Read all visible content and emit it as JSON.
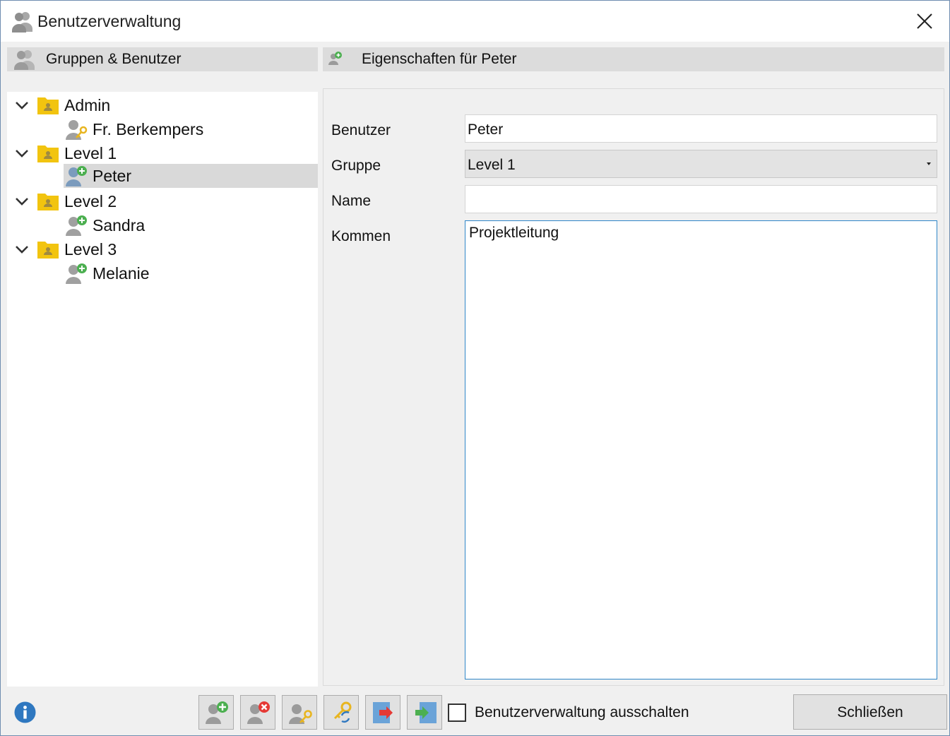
{
  "window": {
    "title": "Benutzerverwaltung",
    "title_icon": "users-icon",
    "close_icon": "close-icon"
  },
  "left_panel": {
    "header_label": "Gruppen & Benutzer",
    "header_icon": "users-icon"
  },
  "right_panel": {
    "header_label": "Eigenschaften für Peter",
    "header_icon": "user-add-icon"
  },
  "tree": {
    "items": [
      {
        "type": "group",
        "label": "Admin",
        "expanded": true
      },
      {
        "type": "user",
        "label": "Fr. Berkempers",
        "icon": "user-key-icon"
      },
      {
        "type": "group",
        "label": "Level 1",
        "expanded": true
      },
      {
        "type": "user",
        "label": "Peter",
        "icon": "user-add-icon",
        "selected": true
      },
      {
        "type": "group",
        "label": "Level 2",
        "expanded": true
      },
      {
        "type": "user",
        "label": "Sandra",
        "icon": "user-add-icon"
      },
      {
        "type": "group",
        "label": "Level 3",
        "expanded": true
      },
      {
        "type": "user",
        "label": "Melanie",
        "icon": "user-add-icon"
      }
    ]
  },
  "form": {
    "benutzer_label": "Benutzer",
    "benutzer_value": "Peter",
    "gruppe_label": "Gruppe",
    "gruppe_value": "Level 1",
    "name_label": "Name",
    "name_value": "",
    "kommen_label": "Kommen",
    "kommen_value": "Projektleitung"
  },
  "toolbar": {
    "buttons": [
      "add-user-icon",
      "delete-user-icon",
      "user-password-icon",
      "change-key-icon",
      "export-icon",
      "import-icon"
    ],
    "checkbox_label": "Benutzerverwaltung ausschalten",
    "checkbox_checked": false,
    "close_label": "Schließen",
    "info_icon": "info-icon"
  },
  "colors": {
    "folder": "#f2c40f",
    "user_gray": "#9b9b9b",
    "user_blue": "#7b9bbd",
    "plus_green": "#4caf50",
    "delete_red": "#e53935",
    "key_gold": "#e8b520",
    "info_blue": "#2f78c0",
    "focus_border": "#2f86c8"
  }
}
